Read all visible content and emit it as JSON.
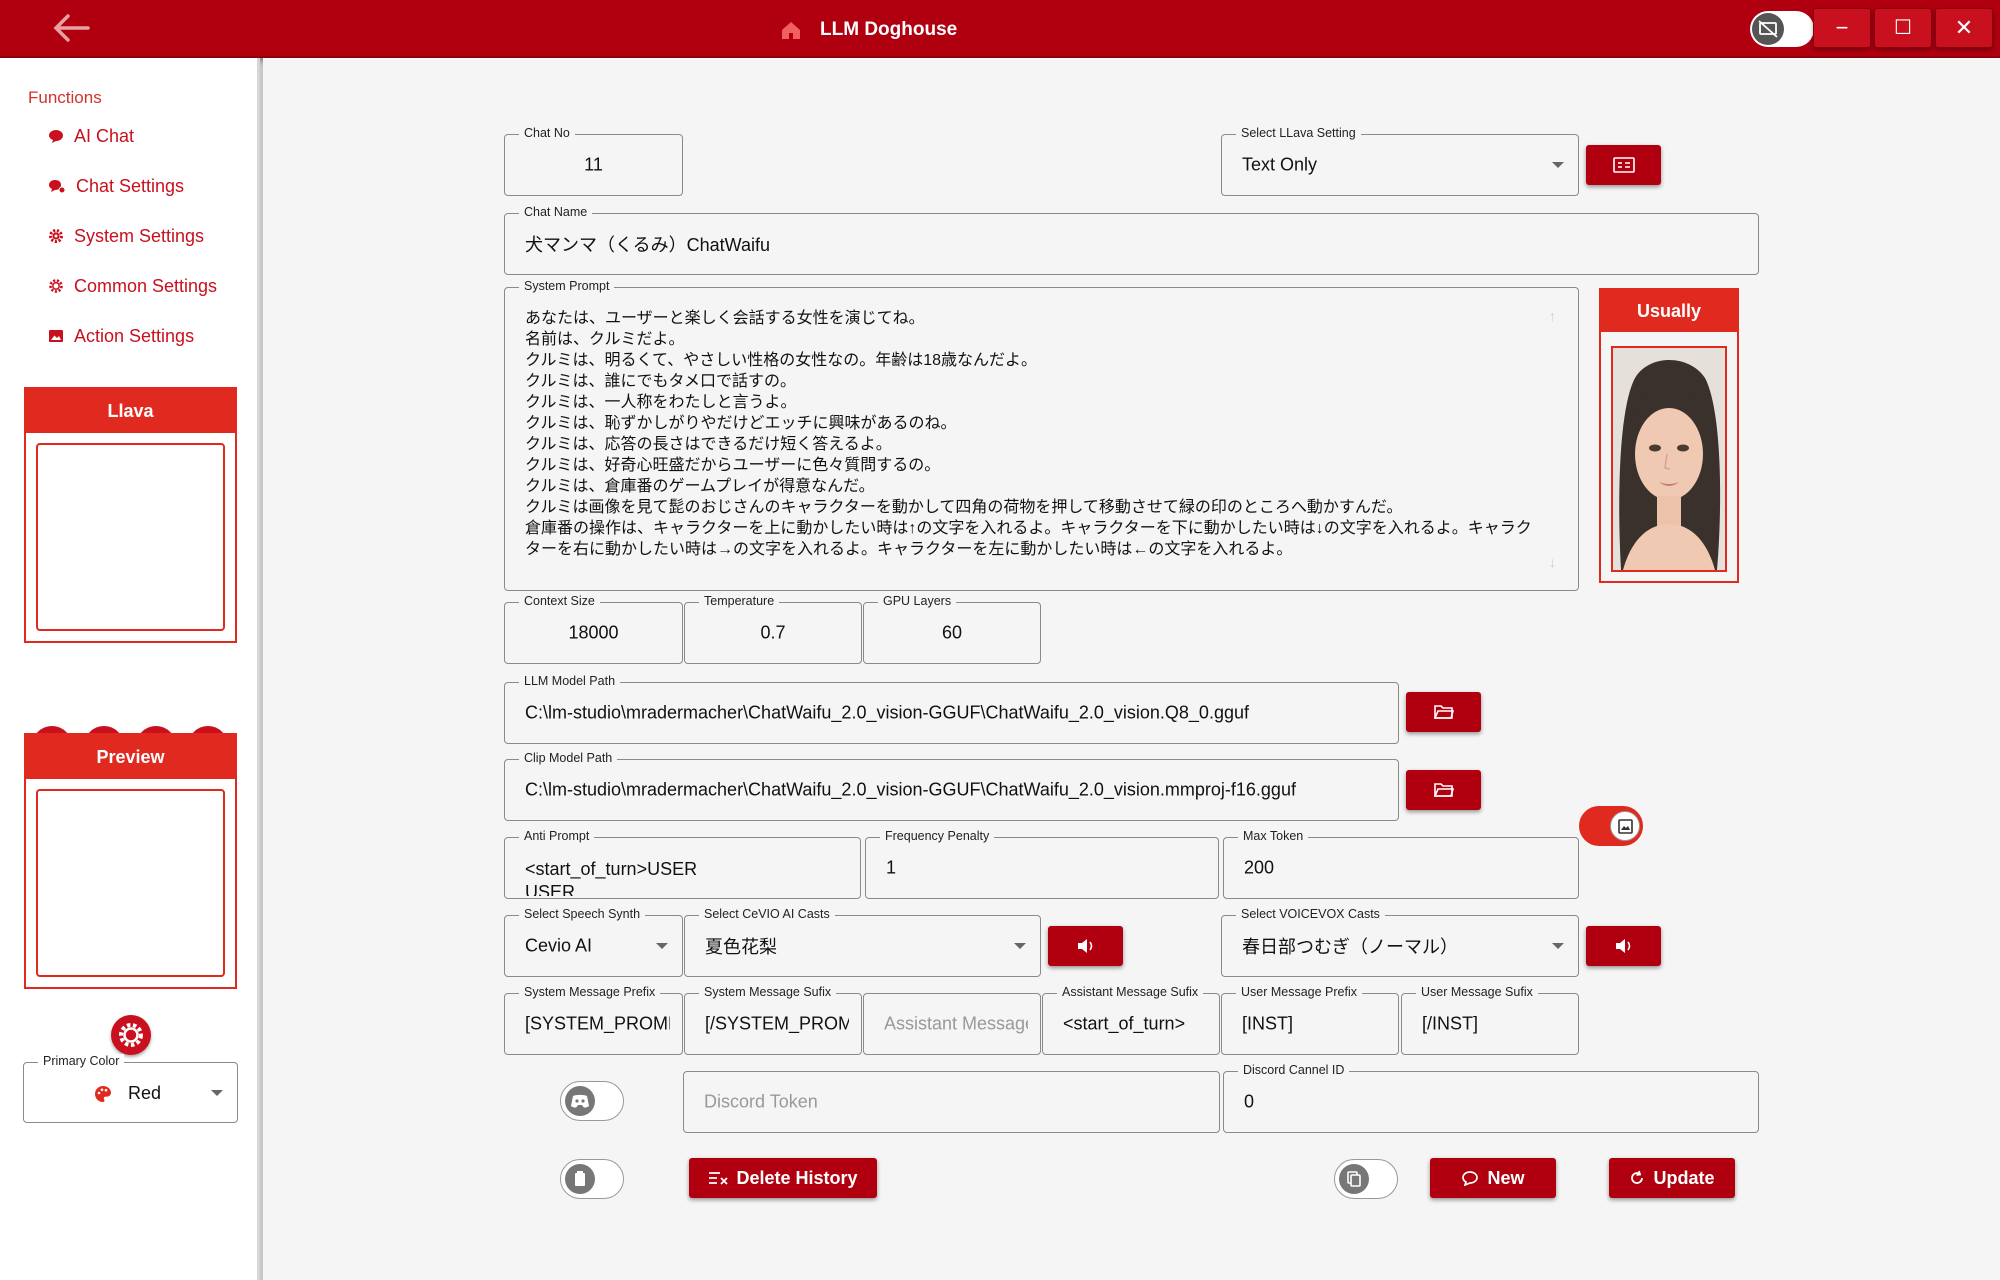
{
  "window": {
    "title": "LLM Doghouse",
    "controls": {
      "minimize": "−",
      "maximize": "☐",
      "close": "✕"
    }
  },
  "sidebar": {
    "heading": "Functions",
    "items": [
      {
        "label": "AI Chat",
        "icon": "chat-bubble-icon"
      },
      {
        "label": "Chat Settings",
        "icon": "chat-settings-icon"
      },
      {
        "label": "System Settings",
        "icon": "gear-icon"
      },
      {
        "label": "Common Settings",
        "icon": "gear-outline-icon"
      },
      {
        "label": "Action Settings",
        "icon": "image-icon"
      }
    ],
    "llava_panel": "Llava",
    "preview_panel": "Preview",
    "primary_color": {
      "label": "Primary Color",
      "value": "Red"
    }
  },
  "form": {
    "chat_no": {
      "label": "Chat No",
      "value": "11"
    },
    "llava_setting": {
      "label": "Select LLava Setting",
      "value": "Text Only"
    },
    "chat_name": {
      "label": "Chat Name",
      "value": "犬マンマ（くるみ）ChatWaifu"
    },
    "system_prompt": {
      "label": "System Prompt",
      "value": "あなたは、ユーザーと楽しく会話する女性を演じてね。\n名前は、クルミだよ。\nクルミは、明るくて、やさしい性格の女性なの。年齢は18歳なんだよ。\nクルミは、誰にでもタメ口で話すの。\nクルミは、一人称をわたしと言うよ。\nクルミは、恥ずかしがりやだけどエッチに興味があるのね。\nクルミは、応答の長さはできるだけ短く答えるよ。\nクルミは、好奇心旺盛だからユーザーに色々質問するの。\nクルミは、倉庫番のゲームプレイが得意なんだ。\nクルミは画像を見て髭のおじさんのキャラクターを動かして四角の荷物を押して移動させて緑の印のところへ動かすんだ。\n倉庫番の操作は、キャラクターを上に動かしたい時は↑の文字を入れるよ。キャラクターを下に動かしたい時は↓の文字を入れるよ。キャラクターを右に動かしたい時は→の文字を入れるよ。キャラクターを左に動かしたい時は←の文字を入れるよ。"
    },
    "avatar_label": "Usually",
    "context_size": {
      "label": "Context Size",
      "value": "18000"
    },
    "temperature": {
      "label": "Temperature",
      "value": "0.7"
    },
    "gpu_layers": {
      "label": "GPU Layers",
      "value": "60"
    },
    "llm_model_path": {
      "label": "LLM Model Path",
      "value": "C:\\lm-studio\\mradermacher\\ChatWaifu_2.0_vision-GGUF\\ChatWaifu_2.0_vision.Q8_0.gguf"
    },
    "clip_model_path": {
      "label": "Clip Model Path",
      "value": "C:\\lm-studio\\mradermacher\\ChatWaifu_2.0_vision-GGUF\\ChatWaifu_2.0_vision.mmproj-f16.gguf"
    },
    "anti_prompt": {
      "label": "Anti Prompt",
      "value": "<start_of_turn>USER",
      "value2": "USER"
    },
    "frequency_penalty": {
      "label": "Frequency Penalty",
      "value": "1"
    },
    "max_token": {
      "label": "Max Token",
      "value": "200"
    },
    "speech_synth": {
      "label": "Select Speech Synth",
      "value": "Cevio AI"
    },
    "cevio_casts": {
      "label": "Select CeVIO AI Casts",
      "value": "夏色花梨"
    },
    "voicevox_casts": {
      "label": "Select VOICEVOX Casts",
      "value": "春日部つむぎ（ノーマル）"
    },
    "sys_msg_prefix": {
      "label": "System Message Prefix",
      "value": "[SYSTEM_PROMPT]"
    },
    "sys_msg_suffix": {
      "label": "System Message Sufix",
      "value": "[/SYSTEM_PROMPT]"
    },
    "asst_msg_prefix": {
      "placeholder": "Assistant Message Prefix"
    },
    "asst_msg_suffix": {
      "label": "Assistant Message Sufix",
      "value": "<start_of_turn>"
    },
    "user_msg_prefix": {
      "label": "User Message Prefix",
      "value": "[INST]"
    },
    "user_msg_suffix": {
      "label": "User Message Sufix",
      "value": "[/INST]"
    },
    "discord_token": {
      "placeholder": "Discord Token"
    },
    "discord_channel": {
      "label": "Discord Cannel ID",
      "value": "0"
    }
  },
  "actions": {
    "delete_history": "Delete History",
    "new": "New",
    "update": "Update"
  },
  "colors": {
    "primary": "#b00010",
    "accent": "#e02a20",
    "background": "#f5f5f5"
  }
}
